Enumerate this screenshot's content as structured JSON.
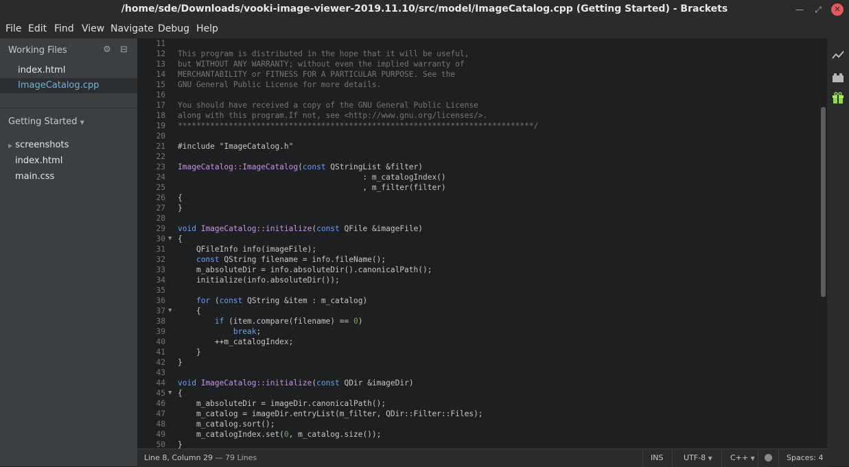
{
  "window": {
    "title": "/home/sde/Downloads/vooki-image-viewer-2019.11.10/src/model/ImageCatalog.cpp (Getting Started) - Brackets",
    "minimize_icon": "minimize-icon",
    "maximize_icon": "maximize-icon",
    "close_icon": "close-icon"
  },
  "menu": [
    "File",
    "Edit",
    "Find",
    "View",
    "Navigate",
    "Debug",
    "Help"
  ],
  "sidebar": {
    "working_files_label": "Working Files",
    "working_files": [
      {
        "name": "index.html",
        "selected": false
      },
      {
        "name": "ImageCatalog.cpp",
        "selected": true
      }
    ],
    "project_label": "Getting Started",
    "tree": [
      {
        "name": "screenshots",
        "type": "folder"
      },
      {
        "name": "index.html",
        "type": "file"
      },
      {
        "name": "main.css",
        "type": "file"
      }
    ]
  },
  "editor": {
    "lines": [
      {
        "n": "11",
        "fold": "",
        "code": ""
      },
      {
        "n": "12",
        "fold": "",
        "tokens": [
          [
            "c",
            "This program is distributed in the hope that it will be useful,"
          ]
        ]
      },
      {
        "n": "13",
        "fold": "",
        "tokens": [
          [
            "c",
            "but WITHOUT ANY WARRANTY; without even the implied warranty of"
          ]
        ]
      },
      {
        "n": "14",
        "fold": "",
        "tokens": [
          [
            "c",
            "MERCHANTABILITY or FITNESS FOR A PARTICULAR PURPOSE. See the"
          ]
        ]
      },
      {
        "n": "15",
        "fold": "",
        "tokens": [
          [
            "c",
            "GNU General Public License for more details."
          ]
        ]
      },
      {
        "n": "16",
        "fold": "",
        "tokens": []
      },
      {
        "n": "17",
        "fold": "",
        "tokens": [
          [
            "c",
            "You should have received a copy of the GNU General Public License"
          ]
        ]
      },
      {
        "n": "18",
        "fold": "",
        "tokens": [
          [
            "c",
            "along with this program.If not, see <http://www.gnu.org/licenses/>."
          ]
        ]
      },
      {
        "n": "19",
        "fold": "",
        "tokens": [
          [
            "c",
            "*****************************************************************************/"
          ]
        ]
      },
      {
        "n": "20",
        "fold": "",
        "tokens": []
      },
      {
        "n": "21",
        "fold": "",
        "tokens": [
          [
            "p",
            "#include \"ImageCatalog.h\""
          ]
        ]
      },
      {
        "n": "22",
        "fold": "",
        "tokens": []
      },
      {
        "n": "23",
        "fold": "",
        "tokens": [
          [
            "f",
            "ImageCatalog::ImageCatalog"
          ],
          [
            "p",
            "("
          ],
          [
            "k",
            "const"
          ],
          [
            "p",
            " QStringList &filter)"
          ]
        ]
      },
      {
        "n": "24",
        "fold": "",
        "tokens": [
          [
            "p",
            "                                        : m_catalogIndex()"
          ]
        ]
      },
      {
        "n": "25",
        "fold": "",
        "tokens": [
          [
            "p",
            "                                        , m_filter(filter)"
          ]
        ]
      },
      {
        "n": "26",
        "fold": "",
        "tokens": [
          [
            "p",
            "{"
          ]
        ]
      },
      {
        "n": "27",
        "fold": "",
        "tokens": [
          [
            "p",
            "}"
          ]
        ]
      },
      {
        "n": "28",
        "fold": "",
        "tokens": []
      },
      {
        "n": "29",
        "fold": "",
        "tokens": [
          [
            "k",
            "void"
          ],
          [
            "p",
            " "
          ],
          [
            "f",
            "ImageCatalog::initialize"
          ],
          [
            "p",
            "("
          ],
          [
            "k",
            "const"
          ],
          [
            "p",
            " QFile &imageFile)"
          ]
        ]
      },
      {
        "n": "30",
        "fold": "▼",
        "tokens": [
          [
            "p",
            "{"
          ]
        ]
      },
      {
        "n": "31",
        "fold": "",
        "tokens": [
          [
            "p",
            "    QFileInfo info(imageFile);"
          ]
        ]
      },
      {
        "n": "32",
        "fold": "",
        "tokens": [
          [
            "p",
            "    "
          ],
          [
            "k",
            "const"
          ],
          [
            "p",
            " QString filename = info.fileName();"
          ]
        ]
      },
      {
        "n": "33",
        "fold": "",
        "tokens": [
          [
            "p",
            "    m_absoluteDir = info.absoluteDir().canonicalPath();"
          ]
        ]
      },
      {
        "n": "34",
        "fold": "",
        "tokens": [
          [
            "p",
            "    initialize(info.absoluteDir());"
          ]
        ]
      },
      {
        "n": "35",
        "fold": "",
        "tokens": []
      },
      {
        "n": "36",
        "fold": "",
        "tokens": [
          [
            "p",
            "    "
          ],
          [
            "k",
            "for"
          ],
          [
            "p",
            " ("
          ],
          [
            "k",
            "const"
          ],
          [
            "p",
            " QString &item : m_catalog)"
          ]
        ]
      },
      {
        "n": "37",
        "fold": "▼",
        "tokens": [
          [
            "p",
            "    {"
          ]
        ]
      },
      {
        "n": "38",
        "fold": "",
        "tokens": [
          [
            "p",
            "        "
          ],
          [
            "k",
            "if"
          ],
          [
            "p",
            " (item.compare(filename) == "
          ],
          [
            "n",
            "0"
          ],
          [
            "p",
            ")"
          ]
        ]
      },
      {
        "n": "39",
        "fold": "",
        "tokens": [
          [
            "p",
            "            "
          ],
          [
            "k",
            "break"
          ],
          [
            "p",
            ";"
          ]
        ]
      },
      {
        "n": "40",
        "fold": "",
        "tokens": [
          [
            "p",
            "        ++m_catalogIndex;"
          ]
        ]
      },
      {
        "n": "41",
        "fold": "",
        "tokens": [
          [
            "p",
            "    }"
          ]
        ]
      },
      {
        "n": "42",
        "fold": "",
        "tokens": [
          [
            "p",
            "}"
          ]
        ]
      },
      {
        "n": "43",
        "fold": "",
        "tokens": []
      },
      {
        "n": "44",
        "fold": "",
        "tokens": [
          [
            "k",
            "void"
          ],
          [
            "p",
            " "
          ],
          [
            "f",
            "ImageCatalog::initialize"
          ],
          [
            "p",
            "("
          ],
          [
            "k",
            "const"
          ],
          [
            "p",
            " QDir &imageDir)"
          ]
        ]
      },
      {
        "n": "45",
        "fold": "▼",
        "tokens": [
          [
            "p",
            "{"
          ]
        ]
      },
      {
        "n": "46",
        "fold": "",
        "tokens": [
          [
            "p",
            "    m_absoluteDir = imageDir.canonicalPath();"
          ]
        ]
      },
      {
        "n": "47",
        "fold": "",
        "tokens": [
          [
            "p",
            "    m_catalog = imageDir.entryList(m_filter, QDir::Filter::Files);"
          ]
        ]
      },
      {
        "n": "48",
        "fold": "",
        "tokens": [
          [
            "p",
            "    m_catalog.sort();"
          ]
        ]
      },
      {
        "n": "49",
        "fold": "",
        "tokens": [
          [
            "p",
            "    m_catalogIndex.set("
          ],
          [
            "n",
            "0"
          ],
          [
            "p",
            ", m_catalog.size());"
          ]
        ]
      },
      {
        "n": "50",
        "fold": "",
        "tokens": [
          [
            "p",
            "}"
          ]
        ]
      }
    ]
  },
  "status": {
    "cursor": "Line 8, Column 29",
    "lines": "— 79 Lines",
    "mode": "INS",
    "encoding": "UTF-8",
    "language": "C++",
    "spaces": "Spaces: 4"
  },
  "colors": {
    "accent": "#6cb4e4",
    "keyword": "#6c9ef8",
    "function": "#c792ea",
    "comment": "#767676",
    "number": "#7fa35a",
    "extension_manager": "#8fd94f"
  }
}
